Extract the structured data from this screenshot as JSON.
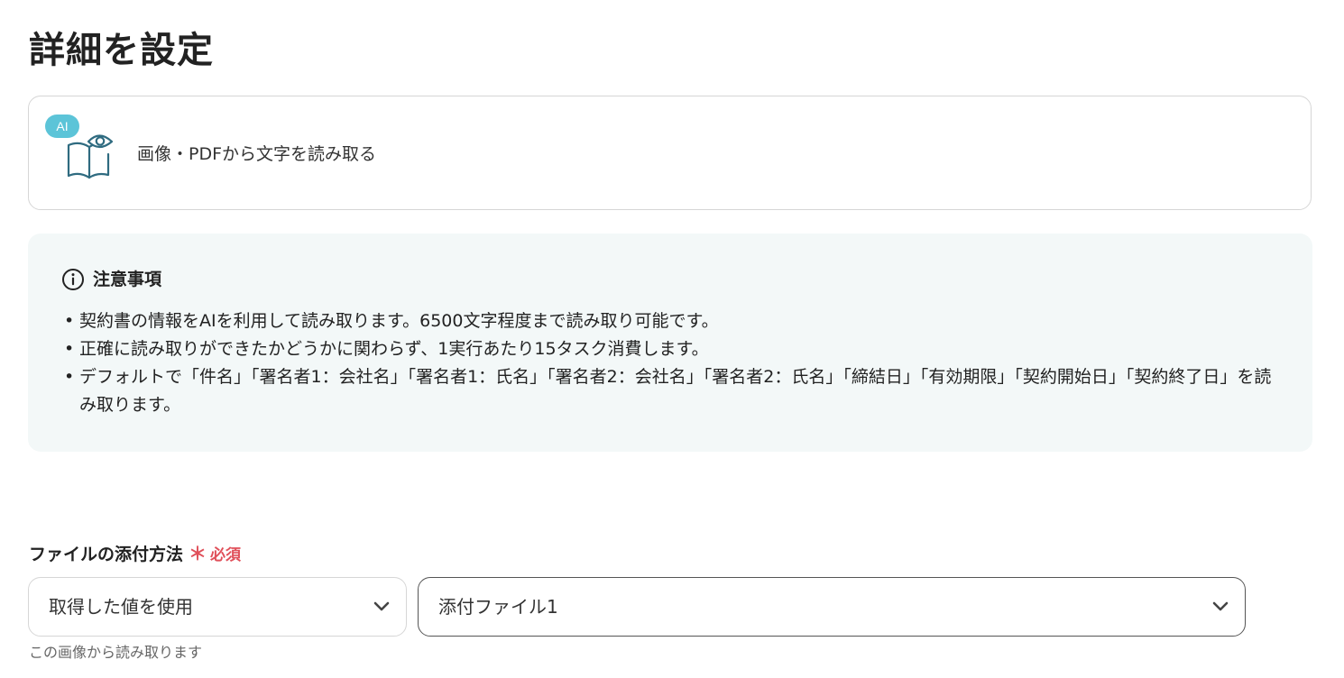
{
  "page": {
    "title": "詳細を設定"
  },
  "action": {
    "badge": "AI",
    "label": "画像・PDFから文字を読み取る",
    "icon": "book-eye-icon"
  },
  "notice": {
    "icon": "info-icon",
    "title": "注意事項",
    "items": [
      "契約書の情報をAIを利用して読み取ります。6500文字程度まで読み取り可能です。",
      "正確に読み取りができたかどうかに関わらず、1実行あたり15タスク消費します。",
      "デフォルトで「件名」「署名者1：会社名」「署名者1：氏名」「署名者2：会社名」「署名者2：氏名」「締結日」「有効期限」「契約開始日」「契約終了日」を読み取ります。"
    ]
  },
  "field": {
    "label": "ファイルの添付方法",
    "required_mark": "＊",
    "required_text": "必須",
    "source_select": {
      "value": "取得した値を使用"
    },
    "file_select": {
      "value": "添付ファイル1"
    },
    "helper": "この画像から読み取ります"
  },
  "colors": {
    "accent_badge": "#5cc4d8",
    "required": "#e0505a",
    "notice_bg": "#f3f8f8",
    "icon_stroke": "#2f6b80"
  }
}
